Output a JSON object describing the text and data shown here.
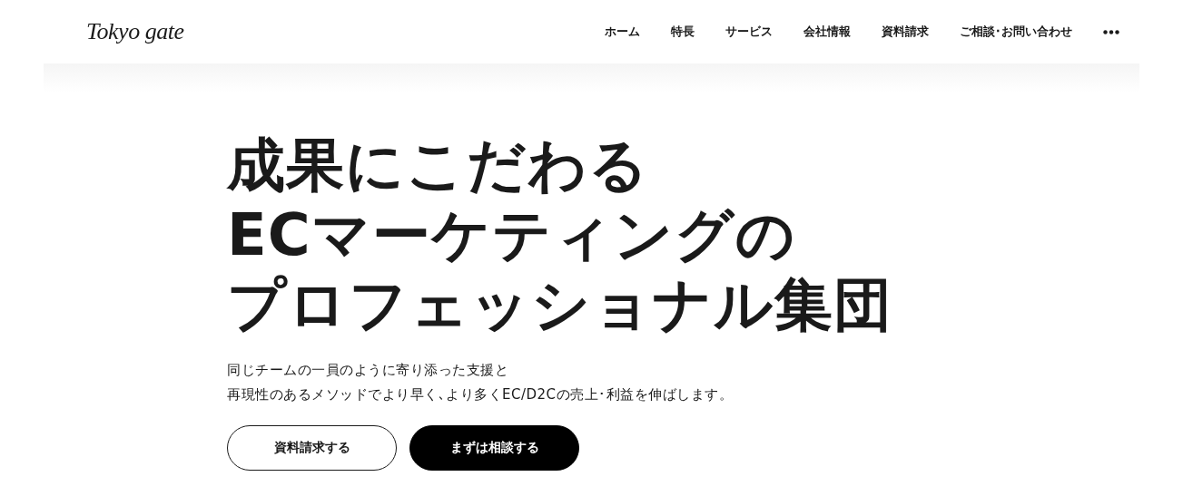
{
  "header": {
    "logo": "Tokyo gate",
    "nav": [
      {
        "label": "ホーム"
      },
      {
        "label": "特長"
      },
      {
        "label": "サービス"
      },
      {
        "label": "会社情報"
      },
      {
        "label": "資料請求"
      },
      {
        "label": "ご相談･お問い合わせ"
      }
    ]
  },
  "hero": {
    "headline": [
      "成果にこだわる",
      "ECマーケティングの",
      "プロフェッショナル集団"
    ],
    "description": [
      "同じチームの一員のように寄り添った支援と",
      "再現性のあるメソッドでより早く､より多くEC/D2Cの売上･利益を伸ばします。"
    ],
    "buttons": [
      {
        "label": "資料請求する",
        "kind": "outline"
      },
      {
        "label": "まずは相談する",
        "kind": "filled"
      }
    ]
  }
}
